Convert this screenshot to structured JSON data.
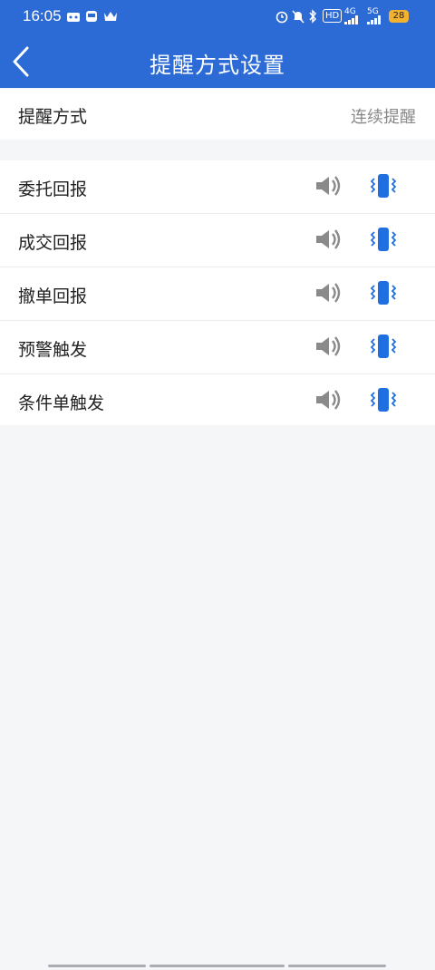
{
  "status_bar": {
    "time": "16:05",
    "network_4g": "4G",
    "network_5g": "5G",
    "battery": "28",
    "hd_label": "HD"
  },
  "header": {
    "title": "提醒方式设置"
  },
  "reminder_mode": {
    "label": "提醒方式",
    "value": "连续提醒"
  },
  "items": [
    {
      "label": "委托回报"
    },
    {
      "label": "成交回报"
    },
    {
      "label": "撤单回报"
    },
    {
      "label": "预警触发"
    },
    {
      "label": "条件单触发"
    }
  ],
  "colors": {
    "header_bg": "#2c6bd6",
    "vibrate_blue": "#1f6fe0",
    "speaker_gray": "#8a8a8a"
  }
}
